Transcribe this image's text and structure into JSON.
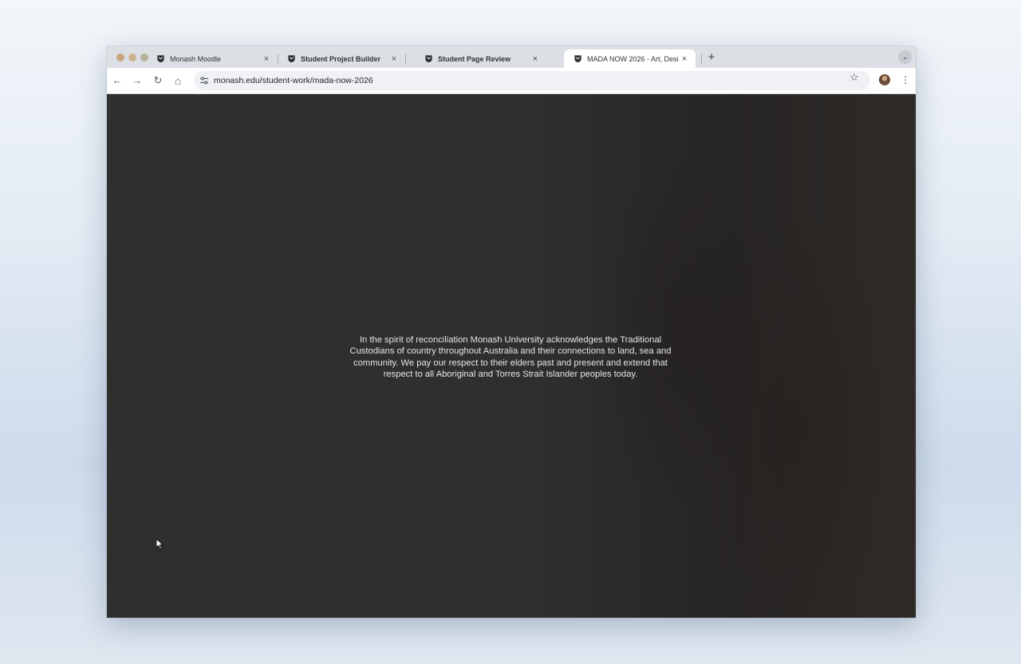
{
  "window_controls": [
    "close",
    "minimize",
    "zoom"
  ],
  "tabs": [
    {
      "label": "Monash Moodle",
      "icon": "monash-crest-icon",
      "active": false
    },
    {
      "label": "Student Project Builder",
      "icon": "monash-crest-icon",
      "active": false
    },
    {
      "label": "Student Page Review",
      "icon": "monash-crest-icon",
      "active": false
    },
    {
      "label": "MADA NOW 2026 - Art, Desi",
      "icon": "monash-crest-icon",
      "active": true
    }
  ],
  "tab_close_glyph": "×",
  "new_tab_glyph": "+",
  "tab_search_glyph": "⌄",
  "toolbar": {
    "back_glyph": "←",
    "forward_glyph": "→",
    "reload_glyph": "↻",
    "home_glyph": "⌂",
    "url": "monash.edu/student-work/mada-now-2026",
    "bookmark_glyph": "☆",
    "menu_glyph": "⋮"
  },
  "page": {
    "acknowledgement": "In the spirit of reconciliation Monash University acknowledges the Traditional Custodians of country throughout Australia and their connections to land, sea and community. We pay our respect to their elders past and present and extend that respect to all Aboriginal and Torres Strait Islander peoples today."
  },
  "colors": {
    "page_background": "#2f2f30",
    "text": "#e6e6e6",
    "tabstrip": "#dcdfe4",
    "omnibox": "#eff1f4"
  }
}
